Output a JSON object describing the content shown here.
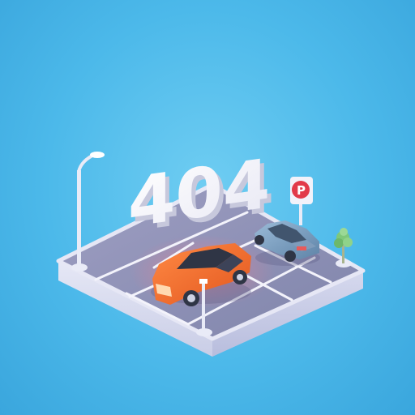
{
  "scene": {
    "sign_text": "404",
    "parking_sign_glyph": "P",
    "colors": {
      "background": "#4cb9ea",
      "platform_top": "#8e8fb4",
      "platform_side": "#d8dcef",
      "lot_lines": "#f3f3fb",
      "car_orange": "#f26a2e",
      "car_blue": "#7c9fc0",
      "parking_sign_red": "#e23a4a",
      "tree_green": "#7fc87a"
    },
    "objects": [
      "404-letters",
      "orange-car",
      "blue-car",
      "street-lamp",
      "parking-sign",
      "small-tree",
      "bollard"
    ]
  }
}
